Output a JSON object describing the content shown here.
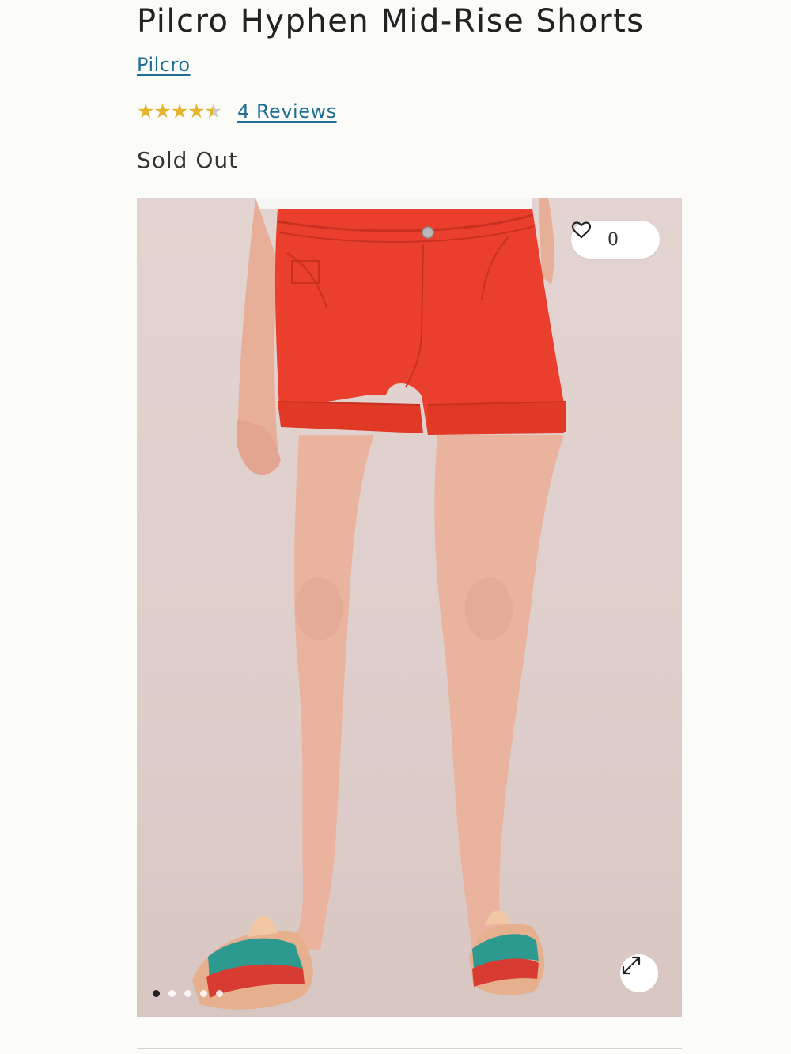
{
  "product": {
    "title": "Pilcro Hyphen Mid-Rise Shorts",
    "brand": "Pilcro",
    "rating": {
      "stars_text": "★★★★★",
      "value": 4.5,
      "max": 5
    },
    "reviews_label": "4 Reviews",
    "availability": "Sold Out"
  },
  "gallery": {
    "favorites_count": "0",
    "image_count": 5,
    "active_index": 0,
    "colors": {
      "shorts": "#ea3f2c",
      "background": "#e2d3d0",
      "skin": "#e8b09a"
    }
  },
  "colors": {
    "link": "#1f6e96",
    "star": "#e5b52d",
    "text": "#222222"
  }
}
